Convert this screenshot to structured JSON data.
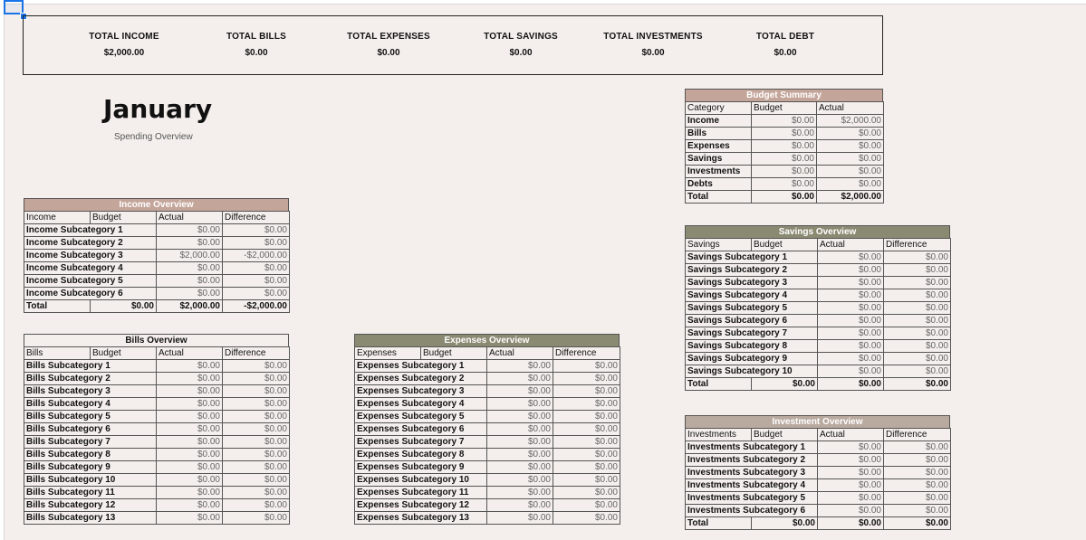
{
  "totals": [
    {
      "label": "TOTAL INCOME",
      "value": "$2,000.00"
    },
    {
      "label": "TOTAL BILLS",
      "value": "$0.00"
    },
    {
      "label": "TOTAL EXPENSES",
      "value": "$0.00"
    },
    {
      "label": "TOTAL SAVINGS",
      "value": "$0.00"
    },
    {
      "label": "TOTAL INVESTMENTS",
      "value": "$0.00"
    },
    {
      "label": "TOTAL DEBT",
      "value": "$0.00"
    }
  ],
  "month": {
    "title": "January",
    "subtitle": "Spending Overview"
  },
  "budget_summary": {
    "title": "Budget Summary",
    "headers": [
      "Category",
      "Budget",
      "Actual"
    ],
    "rows": [
      [
        "Income",
        "$0.00",
        "$2,000.00"
      ],
      [
        "Bills",
        "$0.00",
        "$0.00"
      ],
      [
        "Expenses",
        "$0.00",
        "$0.00"
      ],
      [
        "Savings",
        "$0.00",
        "$0.00"
      ],
      [
        "Investments",
        "$0.00",
        "$0.00"
      ],
      [
        "Debts",
        "$0.00",
        "$0.00"
      ]
    ],
    "total": [
      "Total",
      "$0.00",
      "$2,000.00"
    ]
  },
  "income": {
    "title": "Income Overview",
    "headers": [
      "Income",
      "Budget",
      "Actual",
      "Difference"
    ],
    "rows": [
      [
        "Income Subcategory 1",
        "$0.00",
        "$0.00"
      ],
      [
        "Income Subcategory 2",
        "$0.00",
        "$0.00"
      ],
      [
        "Income Subcategory 3",
        "$2,000.00",
        "-$2,000.00"
      ],
      [
        "Income Subcategory 4",
        "$0.00",
        "$0.00"
      ],
      [
        "Income Subcategory 5",
        "$0.00",
        "$0.00"
      ],
      [
        "Income Subcategory 6",
        "$0.00",
        "$0.00"
      ]
    ],
    "total": [
      "Total",
      "$0.00",
      "$2,000.00",
      "-$2,000.00"
    ]
  },
  "bills": {
    "title": "Bills Overview",
    "headers": [
      "Bills",
      "Budget",
      "Actual",
      "Difference"
    ],
    "rows": [
      [
        "Bills Subcategory 1",
        "$0.00",
        "$0.00"
      ],
      [
        "Bills Subcategory 2",
        "$0.00",
        "$0.00"
      ],
      [
        "Bills Subcategory 3",
        "$0.00",
        "$0.00"
      ],
      [
        "Bills Subcategory 4",
        "$0.00",
        "$0.00"
      ],
      [
        "Bills Subcategory 5",
        "$0.00",
        "$0.00"
      ],
      [
        "Bills Subcategory 6",
        "$0.00",
        "$0.00"
      ],
      [
        "Bills Subcategory 7",
        "$0.00",
        "$0.00"
      ],
      [
        "Bills Subcategory 8",
        "$0.00",
        "$0.00"
      ],
      [
        "Bills Subcategory 9",
        "$0.00",
        "$0.00"
      ],
      [
        "Bills Subcategory 10",
        "$0.00",
        "$0.00"
      ],
      [
        "Bills Subcategory 11",
        "$0.00",
        "$0.00"
      ],
      [
        "Bills Subcategory 12",
        "$0.00",
        "$0.00"
      ],
      [
        "Bills Subcategory 13",
        "$0.00",
        "$0.00"
      ]
    ]
  },
  "expenses": {
    "title": "Expenses Overview",
    "headers": [
      "Expenses",
      "Budget",
      "Actual",
      "Difference"
    ],
    "rows": [
      [
        "Expenses Subcategory 1",
        "$0.00",
        "$0.00"
      ],
      [
        "Expenses Subcategory 2",
        "$0.00",
        "$0.00"
      ],
      [
        "Expenses Subcategory 3",
        "$0.00",
        "$0.00"
      ],
      [
        "Expenses Subcategory 4",
        "$0.00",
        "$0.00"
      ],
      [
        "Expenses Subcategory 5",
        "$0.00",
        "$0.00"
      ],
      [
        "Expenses Subcategory 6",
        "$0.00",
        "$0.00"
      ],
      [
        "Expenses Subcategory 7",
        "$0.00",
        "$0.00"
      ],
      [
        "Expenses Subcategory 8",
        "$0.00",
        "$0.00"
      ],
      [
        "Expenses Subcategory 9",
        "$0.00",
        "$0.00"
      ],
      [
        "Expenses Subcategory 10",
        "$0.00",
        "$0.00"
      ],
      [
        "Expenses Subcategory 11",
        "$0.00",
        "$0.00"
      ],
      [
        "Expenses Subcategory 12",
        "$0.00",
        "$0.00"
      ],
      [
        "Expenses Subcategory 13",
        "$0.00",
        "$0.00"
      ]
    ]
  },
  "savings": {
    "title": "Savings Overview",
    "headers": [
      "Savings",
      "Budget",
      "Actual",
      "Difference"
    ],
    "rows": [
      [
        "Savings Subcategory 1",
        "$0.00",
        "$0.00"
      ],
      [
        "Savings Subcategory 2",
        "$0.00",
        "$0.00"
      ],
      [
        "Savings Subcategory 3",
        "$0.00",
        "$0.00"
      ],
      [
        "Savings Subcategory 4",
        "$0.00",
        "$0.00"
      ],
      [
        "Savings Subcategory 5",
        "$0.00",
        "$0.00"
      ],
      [
        "Savings Subcategory 6",
        "$0.00",
        "$0.00"
      ],
      [
        "Savings Subcategory 7",
        "$0.00",
        "$0.00"
      ],
      [
        "Savings Subcategory 8",
        "$0.00",
        "$0.00"
      ],
      [
        "Savings Subcategory 9",
        "$0.00",
        "$0.00"
      ],
      [
        "Savings Subcategory 10",
        "$0.00",
        "$0.00"
      ]
    ],
    "total": [
      "Total",
      "$0.00",
      "$0.00",
      "$0.00"
    ]
  },
  "investments": {
    "title": "Investment Overview",
    "headers": [
      "Investments",
      "Budget",
      "Actual",
      "Difference"
    ],
    "rows": [
      [
        "Investments Subcategory 1",
        "$0.00",
        "$0.00"
      ],
      [
        "Investments Subcategory 2",
        "$0.00",
        "$0.00"
      ],
      [
        "Investments Subcategory 3",
        "$0.00",
        "$0.00"
      ],
      [
        "Investments Subcategory 4",
        "$0.00",
        "$0.00"
      ],
      [
        "Investments Subcategory 5",
        "$0.00",
        "$0.00"
      ],
      [
        "Investments Subcategory 6",
        "$0.00",
        "$0.00"
      ]
    ],
    "total": [
      "Total",
      "$0.00",
      "$0.00",
      "$0.00"
    ]
  },
  "colors": {
    "rose": "#c4a59a",
    "olive": "#8a8a73",
    "taupe": "#b9aaa0",
    "background": "#f4efec"
  }
}
